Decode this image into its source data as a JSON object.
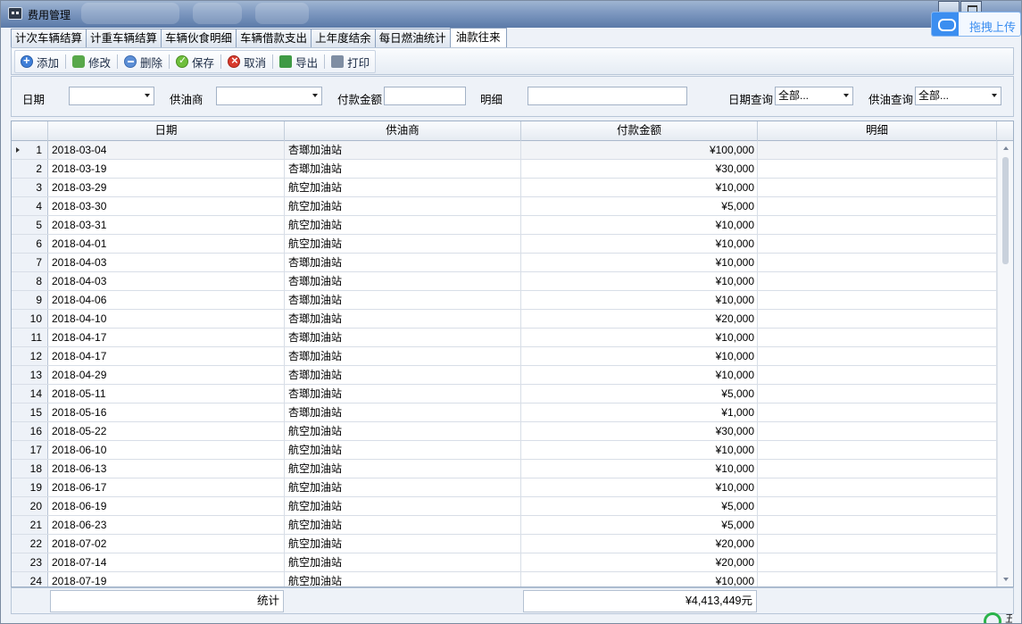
{
  "window": {
    "title": "费用管理"
  },
  "upload": {
    "label": "拖拽上传"
  },
  "tabs": [
    "计次车辆结算",
    "计重车辆结算",
    "车辆伙食明细",
    "车辆借款支出",
    "上年度结余",
    "每日燃油统计",
    "油款往来"
  ],
  "toolbar": {
    "add": "添加",
    "edit": "修改",
    "delete": "删除",
    "save": "保存",
    "cancel": "取消",
    "export": "导出",
    "print": "打印"
  },
  "filter": {
    "date_label": "日期",
    "date_value": "",
    "supplier_label": "供油商",
    "supplier_value": "",
    "amount_label": "付款金额",
    "amount_value": "",
    "detail_label": "明细",
    "detail_value": "",
    "date_query_label": "日期查询",
    "date_query_value": "全部...",
    "supplier_query_label": "供油查询",
    "supplier_query_value": "全部..."
  },
  "table": {
    "columns": [
      "日期",
      "供油商",
      "付款金额",
      "明细"
    ],
    "rows": [
      {
        "n": "1",
        "date": "2018-03-04",
        "supplier": "杏瑯加油站",
        "amount": "¥100,000",
        "detail": ""
      },
      {
        "n": "2",
        "date": "2018-03-19",
        "supplier": "杏瑯加油站",
        "amount": "¥30,000",
        "detail": ""
      },
      {
        "n": "3",
        "date": "2018-03-29",
        "supplier": "航空加油站",
        "amount": "¥10,000",
        "detail": ""
      },
      {
        "n": "4",
        "date": "2018-03-30",
        "supplier": "航空加油站",
        "amount": "¥5,000",
        "detail": ""
      },
      {
        "n": "5",
        "date": "2018-03-31",
        "supplier": "航空加油站",
        "amount": "¥10,000",
        "detail": ""
      },
      {
        "n": "6",
        "date": "2018-04-01",
        "supplier": "航空加油站",
        "amount": "¥10,000",
        "detail": ""
      },
      {
        "n": "7",
        "date": "2018-04-03",
        "supplier": "杏瑯加油站",
        "amount": "¥10,000",
        "detail": ""
      },
      {
        "n": "8",
        "date": "2018-04-03",
        "supplier": "杏瑯加油站",
        "amount": "¥10,000",
        "detail": ""
      },
      {
        "n": "9",
        "date": "2018-04-06",
        "supplier": "杏瑯加油站",
        "amount": "¥10,000",
        "detail": ""
      },
      {
        "n": "10",
        "date": "2018-04-10",
        "supplier": "杏瑯加油站",
        "amount": "¥20,000",
        "detail": ""
      },
      {
        "n": "11",
        "date": "2018-04-17",
        "supplier": "杏瑯加油站",
        "amount": "¥10,000",
        "detail": ""
      },
      {
        "n": "12",
        "date": "2018-04-17",
        "supplier": "杏瑯加油站",
        "amount": "¥10,000",
        "detail": ""
      },
      {
        "n": "13",
        "date": "2018-04-29",
        "supplier": "杏瑯加油站",
        "amount": "¥10,000",
        "detail": ""
      },
      {
        "n": "14",
        "date": "2018-05-11",
        "supplier": "杏瑯加油站",
        "amount": "¥5,000",
        "detail": ""
      },
      {
        "n": "15",
        "date": "2018-05-16",
        "supplier": "杏瑯加油站",
        "amount": "¥1,000",
        "detail": ""
      },
      {
        "n": "16",
        "date": "2018-05-22",
        "supplier": "航空加油站",
        "amount": "¥30,000",
        "detail": ""
      },
      {
        "n": "17",
        "date": "2018-06-10",
        "supplier": "航空加油站",
        "amount": "¥10,000",
        "detail": ""
      },
      {
        "n": "18",
        "date": "2018-06-13",
        "supplier": "航空加油站",
        "amount": "¥10,000",
        "detail": ""
      },
      {
        "n": "19",
        "date": "2018-06-17",
        "supplier": "航空加油站",
        "amount": "¥10,000",
        "detail": ""
      },
      {
        "n": "20",
        "date": "2018-06-19",
        "supplier": "航空加油站",
        "amount": "¥5,000",
        "detail": ""
      },
      {
        "n": "21",
        "date": "2018-06-23",
        "supplier": "航空加油站",
        "amount": "¥5,000",
        "detail": ""
      },
      {
        "n": "22",
        "date": "2018-07-02",
        "supplier": "航空加油站",
        "amount": "¥20,000",
        "detail": ""
      },
      {
        "n": "23",
        "date": "2018-07-14",
        "supplier": "航空加油站",
        "amount": "¥20,000",
        "detail": ""
      },
      {
        "n": "24",
        "date": "2018-07-19",
        "supplier": "航空加油站",
        "amount": "¥10,000",
        "detail": ""
      }
    ]
  },
  "footer": {
    "total_label": "统计",
    "total_value": "¥4,413,449元"
  },
  "corner_text": "五"
}
